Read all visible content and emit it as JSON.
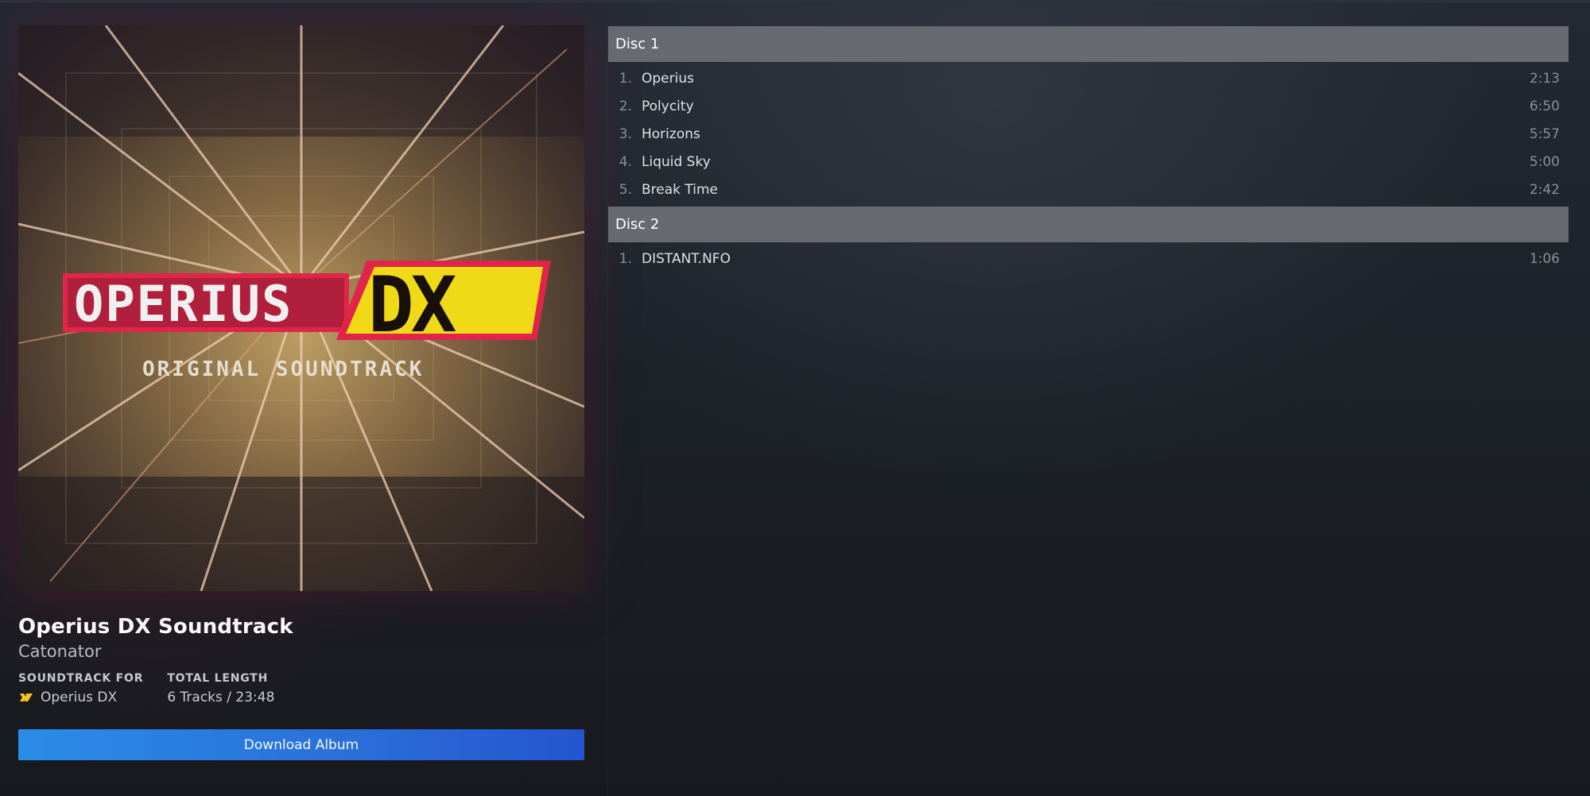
{
  "album": {
    "title": "Operius DX Soundtrack",
    "artist": "Catonator",
    "art": {
      "logo_text": "OPERIUS",
      "logo_suffix": "DX",
      "subtitle": "ORIGINAL SOUNDTRACK"
    },
    "meta": {
      "soundtrack_for_label": "SOUNDTRACK FOR",
      "soundtrack_for_value": "Operius DX",
      "game_icon": "dx-game-icon",
      "total_length_label": "TOTAL LENGTH",
      "total_length_value": "6 Tracks / 23:48"
    },
    "download_label": "Download Album"
  },
  "discs": [
    {
      "label": "Disc 1",
      "tracks": [
        {
          "num": "1.",
          "name": "Operius",
          "duration": "2:13"
        },
        {
          "num": "2.",
          "name": "Polycity",
          "duration": "6:50"
        },
        {
          "num": "3.",
          "name": "Horizons",
          "duration": "5:57"
        },
        {
          "num": "4.",
          "name": "Liquid Sky",
          "duration": "5:00"
        },
        {
          "num": "5.",
          "name": "Break Time",
          "duration": "2:42"
        }
      ]
    },
    {
      "label": "Disc 2",
      "tracks": [
        {
          "num": "1.",
          "name": "DISTANT.NFO",
          "duration": "1:06"
        }
      ]
    }
  ],
  "colors": {
    "accent": "#2b8de8",
    "disc_header": "#676a70",
    "logo_pink": "#f0284f",
    "logo_yellow": "#ffe81a"
  }
}
